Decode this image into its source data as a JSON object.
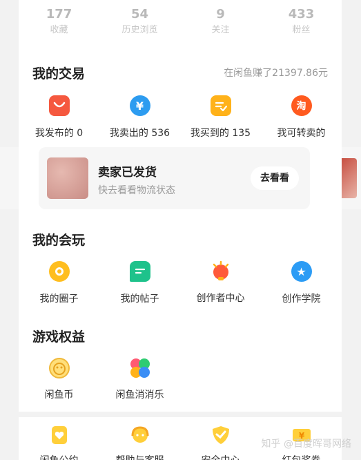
{
  "stats": [
    {
      "value": "177",
      "label": "收藏"
    },
    {
      "value": "54",
      "label": "历史浏览"
    },
    {
      "value": "9",
      "label": "关注"
    },
    {
      "value": "433",
      "label": "粉丝"
    }
  ],
  "trade": {
    "title": "我的交易",
    "earned": "在闲鱼赚了21397.86元",
    "items": [
      {
        "label": "我发布的 0",
        "icon": "bag-icon",
        "color": "#f5583f"
      },
      {
        "label": "我卖出的 536",
        "icon": "yen-icon",
        "color": "#2d9cf0"
      },
      {
        "label": "我买到的 135",
        "icon": "order-check-icon",
        "color": "#ffb21a"
      },
      {
        "label": "我可转卖的",
        "icon": "tao-icon",
        "color": "#ff5a1f",
        "glyph": "淘"
      }
    ]
  },
  "shipment_card": {
    "title": "卖家已发货",
    "subtitle": "快去看看物流状态",
    "button": "去看看"
  },
  "play": {
    "title": "我的会玩",
    "items": [
      {
        "label": "我的圈子",
        "icon": "circle-icon",
        "color": "#ffbe1f"
      },
      {
        "label": "我的帖子",
        "icon": "post-icon",
        "color": "#1ec28b"
      },
      {
        "label": "创作者中心",
        "icon": "bulb-icon",
        "color": "#ff5a3a"
      },
      {
        "label": "创作学院",
        "icon": "star-badge-icon",
        "color": "#2c9cf5"
      }
    ]
  },
  "games": {
    "title": "游戏权益",
    "items": [
      {
        "label": "闲鱼币",
        "icon": "coin-icon",
        "color": "#ffcf55"
      },
      {
        "label": "闲鱼消消乐",
        "icon": "clover-icon",
        "color": "#ff5a73"
      }
    ]
  },
  "bottom": {
    "items": [
      {
        "label": "闲鱼公约",
        "icon": "shield-heart-icon",
        "color": "#ffb21a"
      },
      {
        "label": "帮助与客服",
        "icon": "headset-icon",
        "color": "#ffb21a"
      },
      {
        "label": "安全中心",
        "icon": "shield-check-icon",
        "color": "#ffb21a"
      },
      {
        "label": "红包奖券",
        "icon": "coupon-icon",
        "color": "#ffb21a"
      }
    ]
  },
  "watermark": "知乎 @百度晖哥网络"
}
